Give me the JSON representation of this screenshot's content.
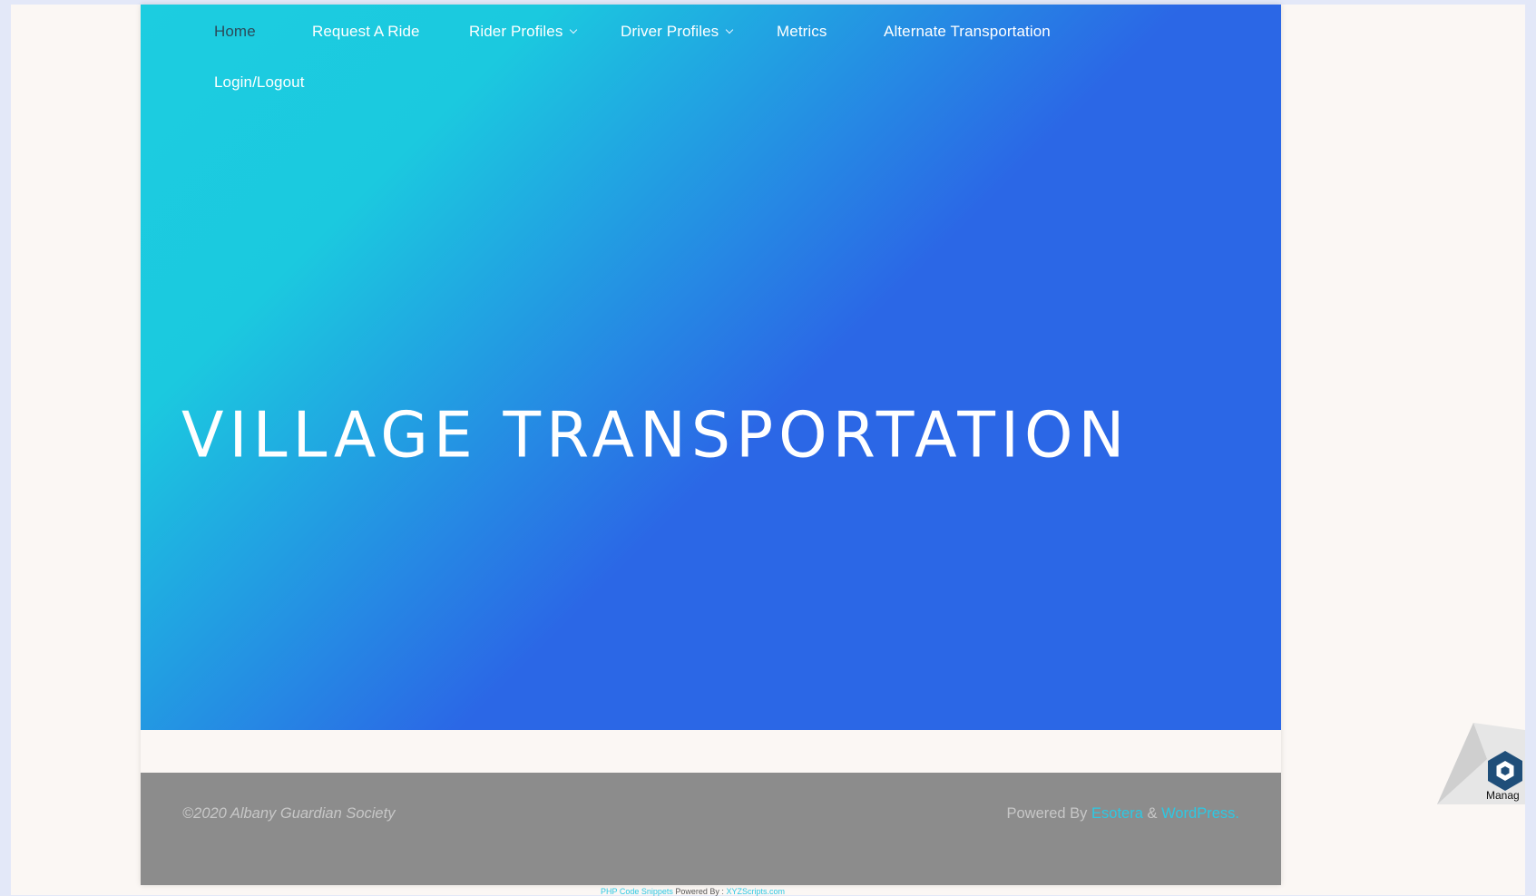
{
  "nav": {
    "items": [
      {
        "label": "Home",
        "active": true,
        "dropdown": false
      },
      {
        "label": "Request A Ride",
        "active": false,
        "dropdown": false
      },
      {
        "label": "Rider Profiles",
        "active": false,
        "dropdown": true
      },
      {
        "label": "Driver Profiles",
        "active": false,
        "dropdown": true
      },
      {
        "label": "Metrics",
        "active": false,
        "dropdown": false
      },
      {
        "label": "Alternate Transportation",
        "active": false,
        "dropdown": false
      },
      {
        "label": "Login/Logout",
        "active": false,
        "dropdown": false
      }
    ]
  },
  "hero": {
    "title": "VILLAGE TRANSPORTATION",
    "gradient_start": "#1ccde0",
    "gradient_end": "#2b67e6"
  },
  "footer": {
    "copyright": "©2020 Albany Guardian Society",
    "powered_prefix": "Powered By",
    "theme_link": "Esotera",
    "ampersand": "&",
    "platform_link": "WordPress.",
    "background": "#8c8c8c",
    "link_color": "#2dc8e3"
  },
  "credit": {
    "snippets_link": "PHP Code Snippets",
    "powered_by": "Powered By :",
    "xyz_link": "XYZScripts.com"
  },
  "widget": {
    "label": "Manag",
    "icon": "hexagon-icon"
  }
}
